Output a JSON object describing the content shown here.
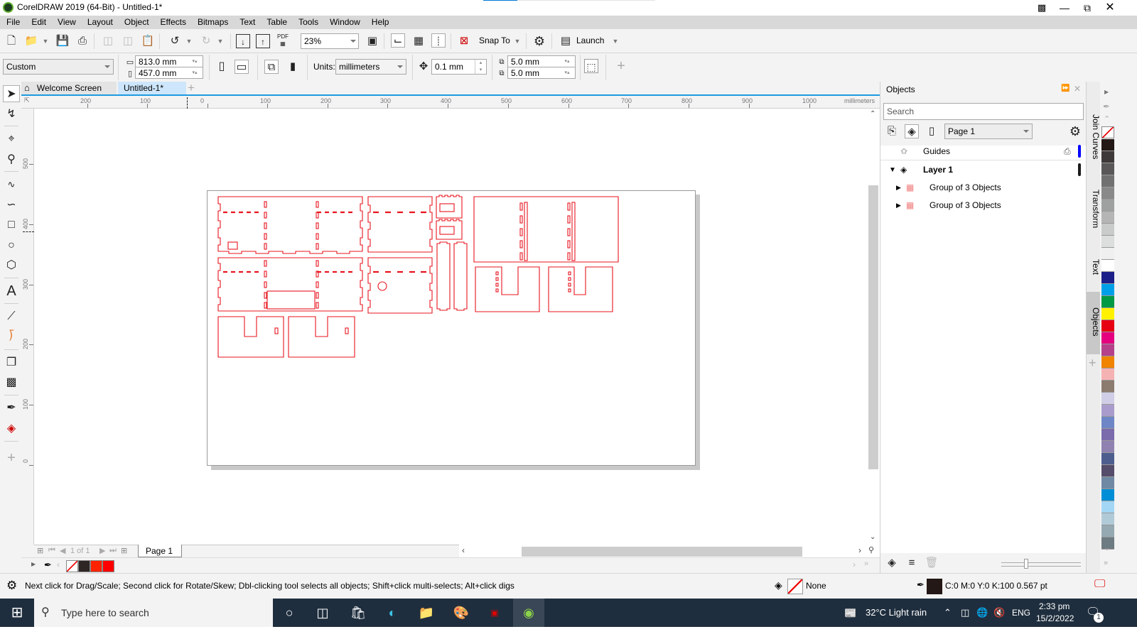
{
  "window": {
    "title": "CorelDRAW 2019 (64-Bit) - Untitled-1*",
    "progress_fraction": 0.2
  },
  "menu": [
    "File",
    "Edit",
    "View",
    "Layout",
    "Object",
    "Effects",
    "Bitmaps",
    "Text",
    "Table",
    "Tools",
    "Window",
    "Help"
  ],
  "toolbar": {
    "zoom_level": "23%",
    "snap_to_label": "Snap To",
    "launch_label": "Launch",
    "pdf_label": "PDF"
  },
  "propertybar": {
    "page_size": "Custom",
    "width": "813.0 mm",
    "height": "457.0 mm",
    "units_label": "Units:",
    "units_value": "millimeters",
    "nudge": "0.1 mm",
    "dup_x": "5.0 mm",
    "dup_y": "5.0 mm"
  },
  "tabs": {
    "welcome": "Welcome Screen",
    "document": "Untitled-1*"
  },
  "rulers": {
    "h_labels": [
      "200",
      "100",
      "0",
      "100",
      "200",
      "300",
      "400",
      "500",
      "600",
      "700",
      "800",
      "900",
      "1000"
    ],
    "h_unit": "millimeters",
    "v_labels": [
      "500",
      "400",
      "300",
      "200",
      "100",
      "0"
    ]
  },
  "pagenav": {
    "counter": "1 of 1",
    "page_tab": "Page 1"
  },
  "doc_palette": {
    "colors": [
      "#2d2624",
      "#ff2200",
      "#ff0000"
    ]
  },
  "objects_panel": {
    "title": "Objects",
    "search_placeholder": "Search",
    "page_select": "Page 1",
    "rows": [
      {
        "label": "Guides",
        "color": "#0000ff"
      },
      {
        "label": "Layer 1",
        "color": "#1b1b1b"
      },
      {
        "label": "Group of 3 Objects"
      },
      {
        "label": "Group of 3 Objects"
      }
    ]
  },
  "dockers": {
    "join_curves": "Join Curves",
    "transform": "Transform",
    "text": "Text",
    "objects": "Objects"
  },
  "palette": {
    "colors": [
      "#231815",
      "#3e3a39",
      "#595757",
      "#727171",
      "#898989",
      "#9fa0a0",
      "#b5b5b6",
      "#c9caca",
      "#dcdddd",
      "#efefef",
      "#ffffff",
      "#1d2088",
      "#00a0e9",
      "#009944",
      "#fff100",
      "#e60012",
      "#e4007f",
      "#b4418a",
      "#f08300",
      "#f5b2b2",
      "#8c7b6f",
      "#d0cde6",
      "#a99ccc",
      "#6f86c6",
      "#7b6aac",
      "#8f82b0",
      "#4e5f8f",
      "#554d6b",
      "#6f88a4",
      "#008ed7",
      "#a3d6f5",
      "#b1cad8",
      "#95a9b2",
      "#6d7b82"
    ]
  },
  "status": {
    "hint": "Next click for Drag/Scale; Second click for Rotate/Skew; Dbl-clicking tool selects all objects; Shift+click multi-selects; Alt+click digs",
    "fill_label": "None",
    "outline_label": "C:0 M:0 Y:0 K:100  0.567 pt"
  },
  "taskbar": {
    "search_placeholder": "Type here to search",
    "weather": "32°C  Light rain",
    "lang": "ENG",
    "time": "2:33 pm",
    "date": "15/2/2022",
    "notif_count": "1"
  }
}
